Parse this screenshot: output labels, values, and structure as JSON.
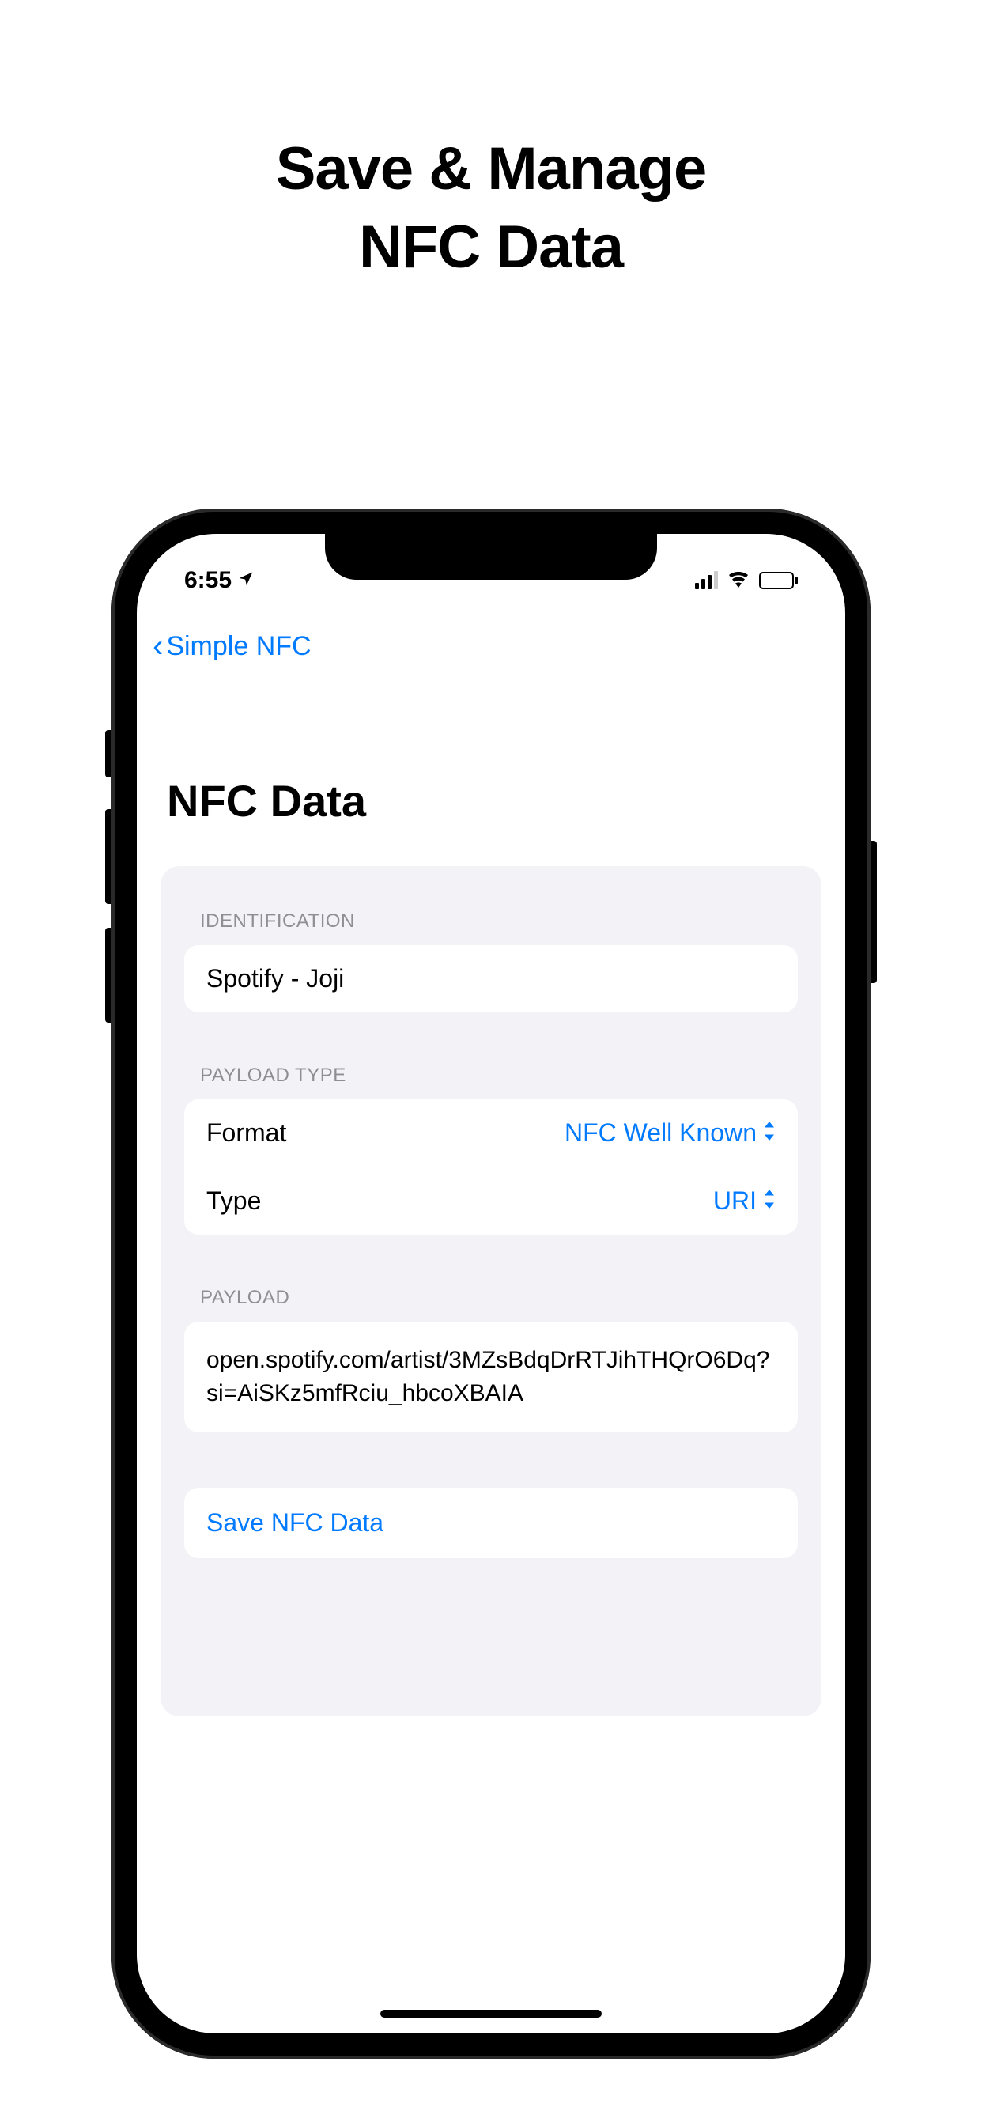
{
  "headline": {
    "line1": "Save & Manage",
    "line2": "NFC Data"
  },
  "statusBar": {
    "time": "6:55"
  },
  "navBar": {
    "backLabel": "Simple NFC"
  },
  "pageTitle": "NFC Data",
  "sections": {
    "identification": {
      "header": "IDENTIFICATION",
      "value": "Spotify - Joji"
    },
    "payloadType": {
      "header": "PAYLOAD TYPE",
      "format": {
        "label": "Format",
        "value": "NFC Well Known"
      },
      "type": {
        "label": "Type",
        "value": "URI"
      }
    },
    "payload": {
      "header": "PAYLOAD",
      "value": "open.spotify.com/artist/3MZsBdqDrRTJihTHQrO6Dq?si=AiSKz5mfRciu_hbcoXBAIA"
    }
  },
  "saveButton": "Save NFC Data"
}
